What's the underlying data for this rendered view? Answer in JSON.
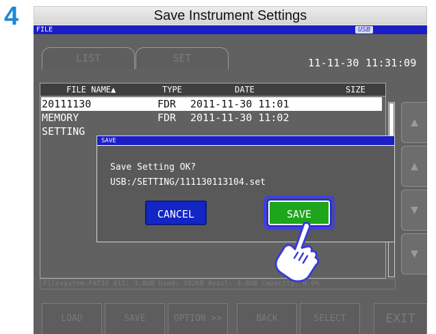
{
  "step": {
    "number": "4",
    "title": "Save Instrument Settings"
  },
  "screen_bar": {
    "label": "FILE",
    "usb_badge": "USB"
  },
  "tabs": [
    {
      "label": "LIST"
    },
    {
      "label": "SET"
    }
  ],
  "datetime": "11-11-30 11:31:09",
  "table": {
    "headers": {
      "name": "FILE NAME▲",
      "type": "TYPE",
      "date": "DATE",
      "size": "SIZE"
    },
    "rows": [
      {
        "name": "20111130",
        "type": "FDR",
        "date": "2011-11-30 11:01",
        "selected": true
      },
      {
        "name": "MEMORY",
        "type": "FDR",
        "date": "2011-11-30 11:02",
        "selected": false
      },
      {
        "name": "SETTING",
        "type": "",
        "date": "",
        "selected": false
      }
    ]
  },
  "status_line": "Filesystem:FAT32 011: 3.8GB Used: 392KB Avail: 3.8GB Capacity: 0.0%",
  "bottom_buttons": [
    {
      "label": "LOAD"
    },
    {
      "label": "SAVE"
    },
    {
      "label": "OPTION >>"
    },
    {
      "label": "BACK"
    },
    {
      "label": "SELECT"
    },
    {
      "label": "EXIT"
    }
  ],
  "dialog": {
    "title": "SAVE",
    "message": "Save Setting OK?",
    "path": "USB:/SETTING/111130113104.set",
    "cancel_label": "CANCEL",
    "save_label": "SAVE"
  },
  "colors": {
    "step_number": "#1e86d6",
    "screen_bar": "#1b1dc5",
    "save_button": "#1ea51a",
    "cancel_button": "#1225c5"
  },
  "icons": {
    "scroll_up": "triangle-up-icon",
    "page_up": "triangle-up-icon",
    "page_down": "triangle-down-icon",
    "scroll_down": "triangle-down-icon",
    "pointer": "pointing-hand-icon"
  }
}
